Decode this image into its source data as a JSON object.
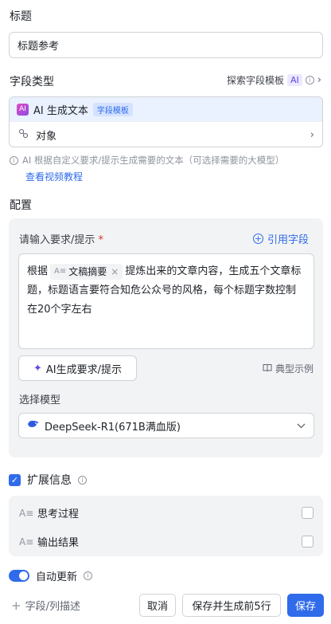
{
  "title_section": {
    "label": "标题",
    "input_value": "标题参考"
  },
  "field_type": {
    "label": "字段类型",
    "explore_text": "探索字段模板",
    "explore_chip": "AI",
    "selected_icon_text": "AI",
    "selected_type": "AI 生成文本",
    "template_chip": "字段模板",
    "sub_option": "对象",
    "hint": "AI 根据自定义要求/提示生成需要的文本（可选择需要的大模型）",
    "tutorial_link": "查看视频教程"
  },
  "config": {
    "label": "配置",
    "prompt_label": "请输入要求/提示",
    "required_mark": "*",
    "cite_field": "引用字段",
    "prompt_before": "根据",
    "field_tag": "文稿摘要",
    "prompt_after": "提炼出来的文章内容，生成五个文章标题，标题语言要符合知危公众号的风格，每个标题字数控制在20个字左右",
    "ai_generate_btn": "AI生成要求/提示",
    "typical_example": "典型示例",
    "model_label": "选择模型",
    "model_value": "DeepSeek-R1(671B满血版)"
  },
  "extension": {
    "label": "扩展信息",
    "checked": true,
    "items": [
      {
        "label": "思考过程",
        "checked": false
      },
      {
        "label": "输出结果",
        "checked": false
      }
    ]
  },
  "auto_update": {
    "label": "自动更新",
    "enabled": true
  },
  "footer": {
    "add_field": "字段/列描述",
    "cancel": "取消",
    "save_generate": "保存并生成前5行",
    "save": "保存"
  },
  "colors": {
    "accent": "#2f6bea",
    "ai_purple": "#5b4be0",
    "panel_bg": "#f2f3f5"
  }
}
